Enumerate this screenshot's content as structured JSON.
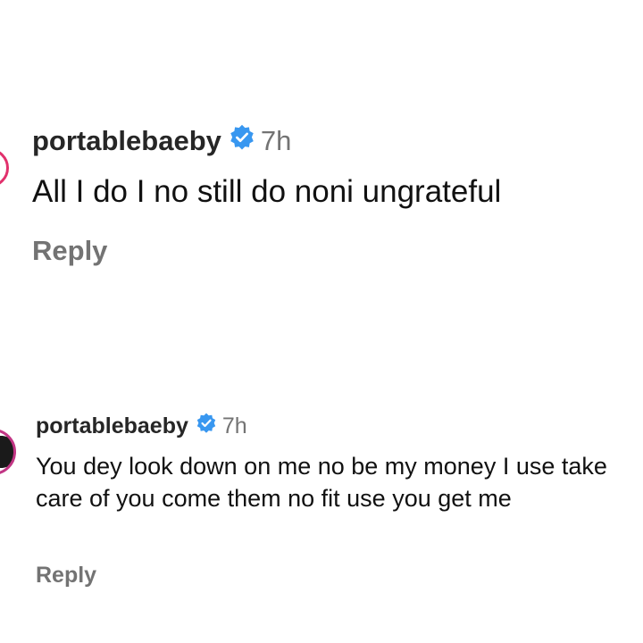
{
  "comments": [
    {
      "username": "portablebaeby",
      "verified_icon": "verified-badge-icon",
      "timestamp": "7h",
      "text": "All I do I no still do noni ungrateful",
      "reply_label": "Reply"
    },
    {
      "username": "portablebaeby",
      "verified_icon": "verified-badge-icon",
      "timestamp": "7h",
      "text": "You dey look down on me no be my money I use take care of you come them no fit use you get me",
      "reply_label": "Reply"
    }
  ],
  "colors": {
    "verified_blue": "#3897f0",
    "muted_text": "#737373",
    "ring_pink": "#e1306c"
  }
}
